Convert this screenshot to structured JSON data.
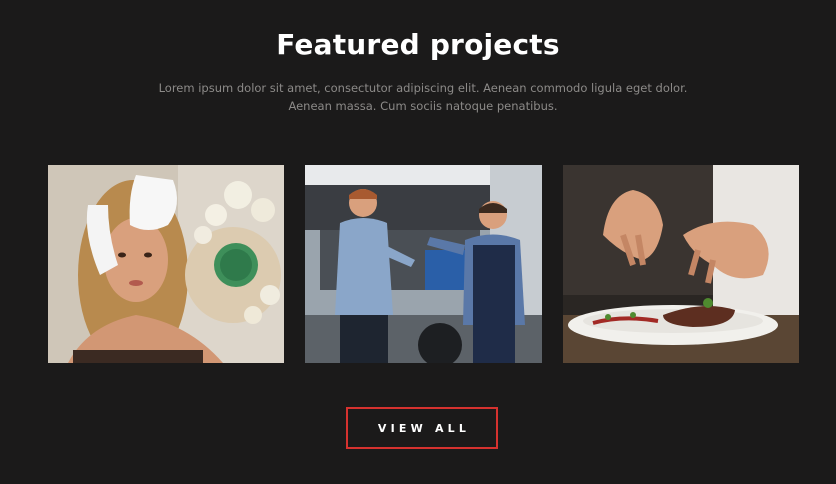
{
  "section": {
    "title": "Featured projects",
    "description_line1": "Lorem ipsum dolor sit amet, consectutor adipiscing elit. Aenean commodo ligula eget dolor.",
    "description_line2": "Aenean massa. Cum sociis natoque penatibus."
  },
  "projects": [
    {
      "image": "spa-facial-treatment-photo"
    },
    {
      "image": "car-mechanic-handing-keys-photo"
    },
    {
      "image": "chef-plating-steak-photo"
    }
  ],
  "cta": {
    "label": "VIEW ALL"
  },
  "colors": {
    "background": "#1b1a1a",
    "accent": "#d6322f",
    "title": "#ffffff",
    "muted": "#8c8a88"
  }
}
